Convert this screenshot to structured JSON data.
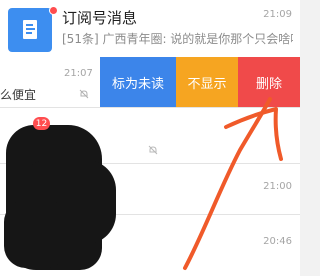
{
  "subscription_row": {
    "title": "订阅号消息",
    "preview": "[51条] 广西青年圈: 说的就是你那个只会啥啥...",
    "time": "21:09",
    "icon": "document-icon"
  },
  "swipe_row": {
    "time": "21:07",
    "partial_text": "么便宜",
    "icon": "bell-muted-icon"
  },
  "swipe_actions": {
    "mark_unread": "标为未读",
    "hide": "不显示",
    "delete": "删除",
    "colors": {
      "mark_unread": "#3c85ea",
      "hide": "#f6a521",
      "delete": "#f04a4a"
    }
  },
  "rows": [
    {
      "badge": "12"
    },
    {
      "time": ""
    },
    {
      "time": "21:00"
    },
    {
      "time": "20:46"
    }
  ],
  "annotation": {
    "color": "#f05a2a",
    "shape": "arrow"
  }
}
